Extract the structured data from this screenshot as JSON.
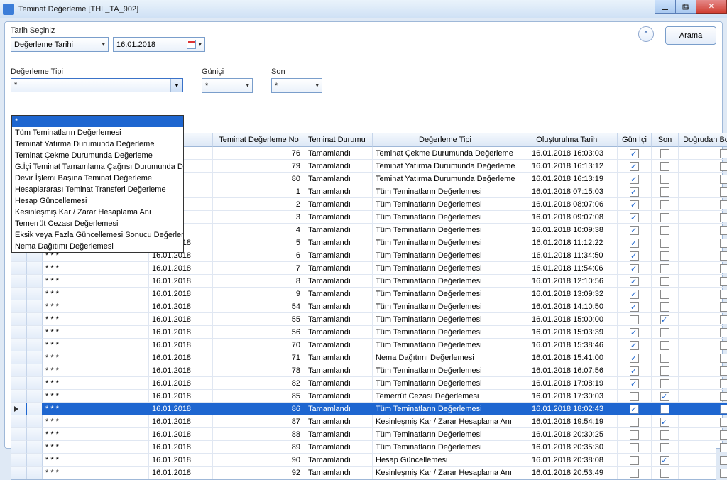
{
  "window": {
    "title": "Teminat Değerleme [THL_TA_902]"
  },
  "header": {
    "date_label": "Tarih Seçiniz",
    "date_type_value": "Değerleme Tarihi",
    "date_value": "16.01.2018",
    "search_label": "Arama"
  },
  "filters": {
    "type_label": "Değerleme Tipi",
    "type_value": "*",
    "gunici_label": "Güniçi",
    "gunici_value": "*",
    "son_label": "Son",
    "son_value": "*"
  },
  "dropdown": {
    "selected": "*",
    "items": [
      "*",
      "Tüm Teminatların Değerlemesi",
      "Teminat Yatırma Durumunda Değerleme",
      "Teminat Çekme Durumunda Değerleme",
      "G.İçi Teminat Tamamlama Çağrısı Durumunda D.",
      "Devir İşlemi Başına Teminat Değerleme",
      "Hesaplararası Teminat Transferi Değerleme",
      "Hesap Güncellemesi",
      "Kesinleşmiş Kar / Zarar Hesaplama Anı",
      "Temerrüt Cezası Değerlemesi",
      "Eksik veya Fazla Güncellemesi Sonucu Değerleme",
      "Nema Dağıtımı Değerlemesi"
    ]
  },
  "grid": {
    "columns": {
      "col_date": "",
      "col_no": "Teminat Değerleme No",
      "col_status": "Teminat Durumu",
      "col_type": "Değerleme Tipi",
      "col_created": "Oluşturulma Tarihi",
      "col_gunici": "Gün İçi",
      "col_son": "Son",
      "col_borclandirma": "Doğrudan Borçlandırma"
    },
    "partial_date": "8",
    "selected_index": 19,
    "rows": [
      {
        "no": 76,
        "status": "Tamamlandı",
        "type": "Teminat Çekme Durumunda Değerleme",
        "created": "16.01.2018 16:03:03",
        "gunici": true,
        "son": false,
        "borc": false
      },
      {
        "no": 79,
        "status": "Tamamlandı",
        "type": "Teminat Yatırma Durumunda Değerleme",
        "created": "16.01.2018 16:13:12",
        "gunici": true,
        "son": false,
        "borc": false
      },
      {
        "no": 80,
        "status": "Tamamlandı",
        "type": "Teminat Yatırma Durumunda Değerleme",
        "created": "16.01.2018 16:13:19",
        "gunici": true,
        "son": false,
        "borc": false
      },
      {
        "no": 1,
        "status": "Tamamlandı",
        "type": "Tüm Teminatların Değerlemesi",
        "created": "16.01.2018 07:15:03",
        "gunici": true,
        "son": false,
        "borc": false
      },
      {
        "no": 2,
        "status": "Tamamlandı",
        "type": "Tüm Teminatların Değerlemesi",
        "created": "16.01.2018 08:07:06",
        "gunici": true,
        "son": false,
        "borc": false
      },
      {
        "no": 3,
        "status": "Tamamlandı",
        "type": "Tüm Teminatların Değerlemesi",
        "created": "16.01.2018 09:07:08",
        "gunici": true,
        "son": false,
        "borc": false
      },
      {
        "no": 4,
        "status": "Tamamlandı",
        "type": "Tüm Teminatların Değerlemesi",
        "created": "16.01.2018 10:09:38",
        "gunici": true,
        "son": false,
        "borc": false
      },
      {
        "date": "16.01.2018",
        "no": 5,
        "status": "Tamamlandı",
        "type": "Tüm Teminatların Değerlemesi",
        "created": "16.01.2018 11:12:22",
        "gunici": true,
        "son": false,
        "borc": false
      },
      {
        "uye": "* * *",
        "date": "16.01.2018",
        "no": 6,
        "status": "Tamamlandı",
        "type": "Tüm Teminatların Değerlemesi",
        "created": "16.01.2018 11:34:50",
        "gunici": true,
        "son": false,
        "borc": false
      },
      {
        "uye": "* * *",
        "date": "16.01.2018",
        "no": 7,
        "status": "Tamamlandı",
        "type": "Tüm Teminatların Değerlemesi",
        "created": "16.01.2018 11:54:06",
        "gunici": true,
        "son": false,
        "borc": false
      },
      {
        "uye": "* * *",
        "date": "16.01.2018",
        "no": 8,
        "status": "Tamamlandı",
        "type": "Tüm Teminatların Değerlemesi",
        "created": "16.01.2018 12:10:56",
        "gunici": true,
        "son": false,
        "borc": false
      },
      {
        "uye": "* * *",
        "date": "16.01.2018",
        "no": 9,
        "status": "Tamamlandı",
        "type": "Tüm Teminatların Değerlemesi",
        "created": "16.01.2018 13:09:32",
        "gunici": true,
        "son": false,
        "borc": false
      },
      {
        "uye": "* * *",
        "date": "16.01.2018",
        "no": 54,
        "status": "Tamamlandı",
        "type": "Tüm Teminatların Değerlemesi",
        "created": "16.01.2018 14:10:50",
        "gunici": true,
        "son": false,
        "borc": false
      },
      {
        "uye": "* * *",
        "date": "16.01.2018",
        "no": 55,
        "status": "Tamamlandı",
        "type": "Tüm Teminatların Değerlemesi",
        "created": "16.01.2018 15:00:00",
        "gunici": false,
        "son": true,
        "borc": false
      },
      {
        "uye": "* * *",
        "date": "16.01.2018",
        "no": 56,
        "status": "Tamamlandı",
        "type": "Tüm Teminatların Değerlemesi",
        "created": "16.01.2018 15:03:39",
        "gunici": true,
        "son": false,
        "borc": false
      },
      {
        "uye": "* * *",
        "date": "16.01.2018",
        "no": 70,
        "status": "Tamamlandı",
        "type": "Tüm Teminatların Değerlemesi",
        "created": "16.01.2018 15:38:46",
        "gunici": true,
        "son": false,
        "borc": false
      },
      {
        "uye": "* * *",
        "date": "16.01.2018",
        "no": 71,
        "status": "Tamamlandı",
        "type": "Nema Dağıtımı Değerlemesi",
        "created": "16.01.2018 15:41:00",
        "gunici": true,
        "son": false,
        "borc": false
      },
      {
        "uye": "* * *",
        "date": "16.01.2018",
        "no": 78,
        "status": "Tamamlandı",
        "type": "Tüm Teminatların Değerlemesi",
        "created": "16.01.2018 16:07:56",
        "gunici": true,
        "son": false,
        "borc": false
      },
      {
        "uye": "* * *",
        "date": "16.01.2018",
        "no": 82,
        "status": "Tamamlandı",
        "type": "Tüm Teminatların Değerlemesi",
        "created": "16.01.2018 17:08:19",
        "gunici": true,
        "son": false,
        "borc": false
      },
      {
        "uye": "* * *",
        "date": "16.01.2018",
        "no": 85,
        "status": "Tamamlandı",
        "type": "Temerrüt Cezası Değerlemesi",
        "created": "16.01.2018 17:30:03",
        "gunici": false,
        "son": true,
        "borc": false
      },
      {
        "uye": "* * *",
        "date": "16.01.2018",
        "no": 86,
        "status": "Tamamlandı",
        "type": "Tüm Teminatların Değerlemesi",
        "created": "16.01.2018 18:02:43",
        "gunici": true,
        "son": false,
        "borc": false,
        "selected": true
      },
      {
        "uye": "* * *",
        "date": "16.01.2018",
        "no": 87,
        "status": "Tamamlandı",
        "type": "Kesinleşmiş Kar / Zarar Hesaplama Anı",
        "created": "16.01.2018 19:54:19",
        "gunici": false,
        "son": true,
        "borc": false
      },
      {
        "uye": "* * *",
        "date": "16.01.2018",
        "no": 88,
        "status": "Tamamlandı",
        "type": "Tüm Teminatların Değerlemesi",
        "created": "16.01.2018 20:30:25",
        "gunici": false,
        "son": false,
        "borc": false
      },
      {
        "uye": "* * *",
        "date": "16.01.2018",
        "no": 89,
        "status": "Tamamlandı",
        "type": "Tüm Teminatların Değerlemesi",
        "created": "16.01.2018 20:35:30",
        "gunici": false,
        "son": false,
        "borc": false
      },
      {
        "uye": "* * *",
        "date": "16.01.2018",
        "no": 90,
        "status": "Tamamlandı",
        "type": "Hesap Güncellemesi",
        "created": "16.01.2018 20:38:08",
        "gunici": false,
        "son": true,
        "borc": false
      },
      {
        "uye": "* * *",
        "date": "16.01.2018",
        "no": 92,
        "status": "Tamamlandı",
        "type": "Kesinleşmiş Kar / Zarar Hesaplama Anı",
        "created": "16.01.2018 20:53:49",
        "gunici": false,
        "son": false,
        "borc": false
      }
    ]
  }
}
